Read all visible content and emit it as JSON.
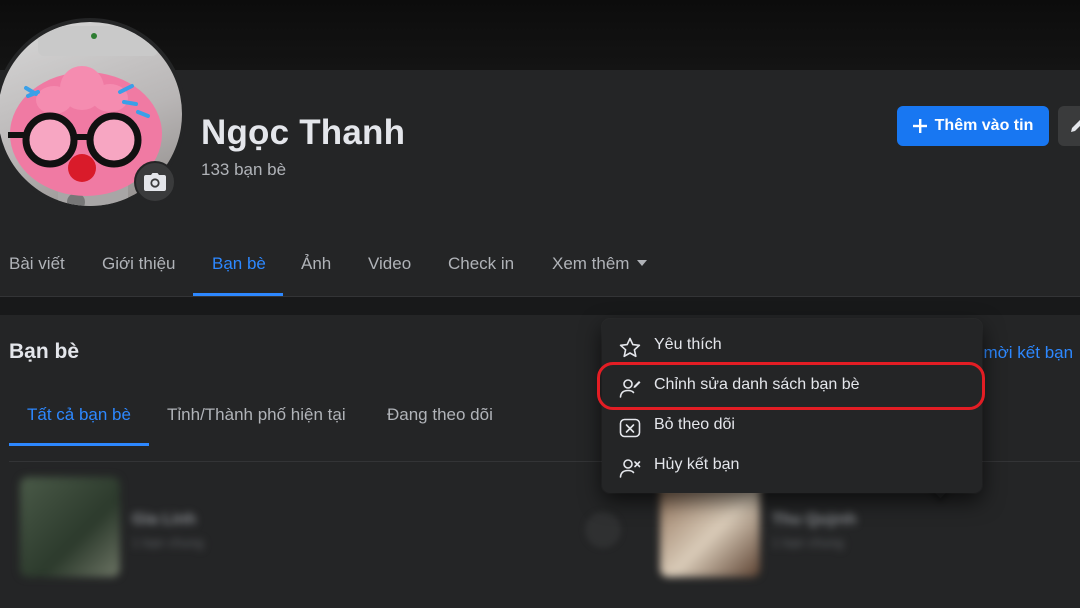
{
  "profile": {
    "name": "Ngọc Thanh",
    "friend_count": "133 bạn bè"
  },
  "header_actions": {
    "add_story_label": "Thêm vào tin",
    "add_story_icon": "plus-icon",
    "edit_icon": "pencil-icon"
  },
  "tabs": [
    {
      "label": "Bài viết",
      "active": false
    },
    {
      "label": "Giới thiệu",
      "active": false
    },
    {
      "label": "Bạn bè",
      "active": true
    },
    {
      "label": "Ảnh",
      "active": false
    },
    {
      "label": "Video",
      "active": false
    },
    {
      "label": "Check in",
      "active": false
    },
    {
      "label": "Xem thêm",
      "active": false
    }
  ],
  "friends_section": {
    "title": "Bạn bè",
    "invite_link": "i mời kết bạn",
    "subtabs": [
      {
        "label": "Tất cả bạn bè",
        "active": true
      },
      {
        "label": "Tỉnh/Thành phố hiện tại",
        "active": false
      },
      {
        "label": "Đang theo dõi",
        "active": false
      }
    ],
    "friends": [
      {
        "name": "Gia Linh",
        "sub": "1 bạn chung"
      },
      {
        "name": "Thu Quỳnh",
        "sub": "1 bạn chung"
      }
    ]
  },
  "dropdown_menu": {
    "items": [
      {
        "label": "Yêu thích",
        "icon": "star-icon"
      },
      {
        "label": "Chỉnh sửa danh sách bạn bè",
        "icon": "edit-friend-list-icon",
        "highlighted": true
      },
      {
        "label": "Bỏ theo dõi",
        "icon": "unfollow-icon"
      },
      {
        "label": "Hủy kết bạn",
        "icon": "unfriend-icon"
      }
    ]
  },
  "colors": {
    "accent": "#2d88ff",
    "button_blue": "#1877f2",
    "highlight_ring": "#e31d24",
    "surface": "#242526",
    "background": "#18191a"
  }
}
